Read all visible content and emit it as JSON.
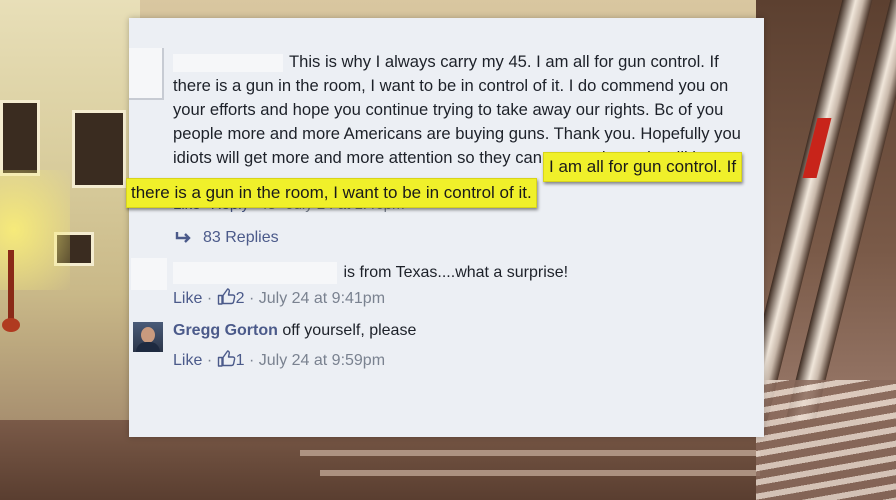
{
  "comment_main": {
    "text": "This is why I always carry my 45. I am all for gun control. If there is a gun in the room, I want to be in control of it. I do commend you on your efforts and hope you continue trying to take away our rights. Bc of you people more and more Americans are buying guns. Thank you. Hopefully you idiots will get more and more attention so they can see and people will buy guns.",
    "actions": {
      "like_label": "Like",
      "reply_label": "Reply",
      "like_count": "45",
      "timestamp": "July 24 at 1:46pm"
    },
    "replies_label": "83 Replies"
  },
  "reply_1": {
    "text": "is from Texas....what a surprise!",
    "like_label": "Like",
    "like_count": "2",
    "timestamp": "July 24 at 9:41pm"
  },
  "reply_2": {
    "author": "Gregg Gorton",
    "text": "off yourself, please",
    "like_label": "Like",
    "like_count": "1",
    "timestamp": "July 24 at 9:59pm"
  },
  "highlight": {
    "line1": "I am all for gun control. If",
    "line2": "there is a gun in the room, I want to be in control of it."
  },
  "separators": {
    "dot": "·"
  },
  "colors": {
    "link_blue": "#4b5a8a",
    "highlight_yellow": "#f0f02a",
    "panel_bg": "#eceff4"
  }
}
